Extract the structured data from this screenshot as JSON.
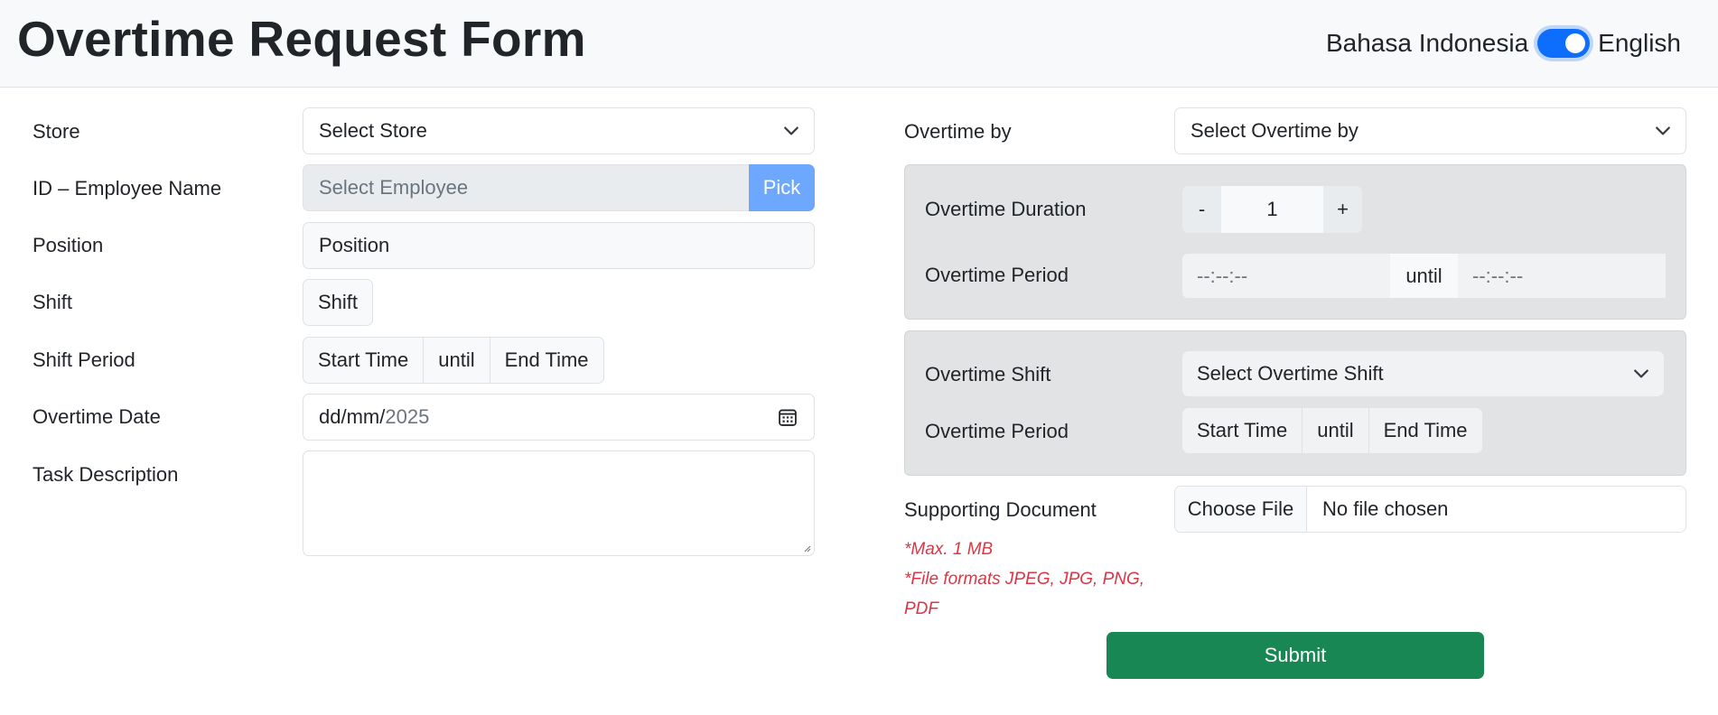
{
  "header": {
    "title": "Overtime Request Form",
    "lang_left": "Bahasa Indonesia",
    "lang_right": "English",
    "toggle_on": true
  },
  "left": {
    "store_label": "Store",
    "store_value": "Select Store",
    "employee_label": "ID – Employee Name",
    "employee_placeholder": "Select Employee",
    "pick_label": "Pick",
    "position_label": "Position",
    "position_value": "Position",
    "shift_label": "Shift",
    "shift_value": "Shift",
    "shift_period_label": "Shift Period",
    "start_time": "Start Time",
    "until": "until",
    "end_time": "End Time",
    "date_label": "Overtime Date",
    "date_value": "dd/mm/",
    "date_year": "2025",
    "task_label": "Task Description"
  },
  "right": {
    "overtime_by_label": "Overtime by",
    "overtime_by_value": "Select Overtime by",
    "duration_panel": {
      "duration_label": "Overtime Duration",
      "minus": "-",
      "value": "1",
      "plus": "+",
      "period_label": "Overtime Period",
      "time_from": "--:--:--",
      "until": "until",
      "time_to": "--:--:--"
    },
    "shift_panel": {
      "shift_label": "Overtime Shift",
      "shift_value": "Select Overtime Shift",
      "period_label": "Overtime Period",
      "start_time": "Start Time",
      "until": "until",
      "end_time": "End Time"
    },
    "document_label": "Supporting Document",
    "choose_file": "Choose File",
    "no_file": "No file chosen",
    "note_size": "*Max. 1 MB",
    "note_formats_1": "*File formats JPEG, JPG, PNG,",
    "note_formats_2": "PDF",
    "submit_label": "Submit"
  },
  "colors": {
    "accent": "#0d6efd",
    "pick": "#6ea8fe",
    "submit": "#198754",
    "note": "#dc3545",
    "panel": "#e2e3e5"
  },
  "icons": [
    "chevron-down-icon",
    "calendar-icon",
    "resize-handle-icon"
  ]
}
